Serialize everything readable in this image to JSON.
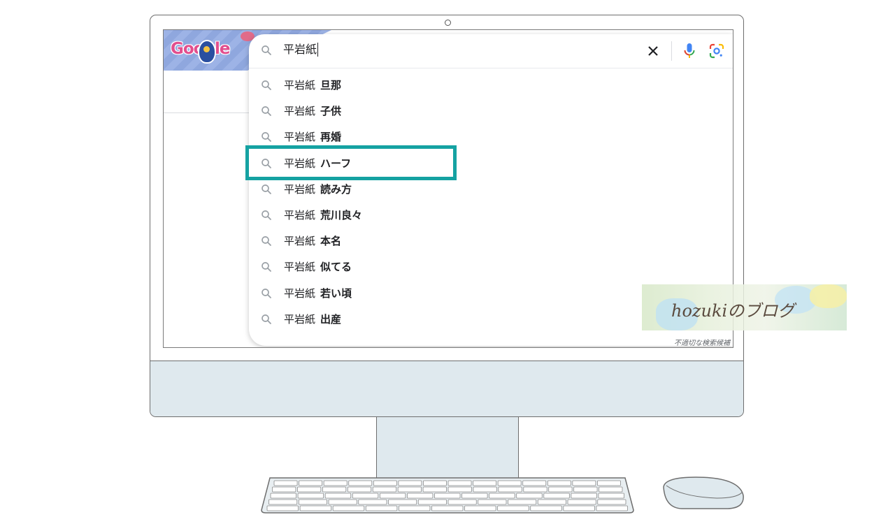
{
  "search": {
    "query": "平岩紙",
    "clear_icon": "close-icon",
    "mic_icon": "microphone-icon",
    "lens_icon": "google-lens-icon"
  },
  "doodle": {
    "logo_text": "Google"
  },
  "suggestions": [
    {
      "query": "平岩紙",
      "completion": "旦那"
    },
    {
      "query": "平岩紙",
      "completion": "子供"
    },
    {
      "query": "平岩紙",
      "completion": "再婚"
    },
    {
      "query": "平岩紙",
      "completion": "ハーフ"
    },
    {
      "query": "平岩紙",
      "completion": "読み方"
    },
    {
      "query": "平岩紙",
      "completion": "荒川良々"
    },
    {
      "query": "平岩紙",
      "completion": "本名"
    },
    {
      "query": "平岩紙",
      "completion": "似てる"
    },
    {
      "query": "平岩紙",
      "completion": "若い頃"
    },
    {
      "query": "平岩紙",
      "completion": "出産"
    }
  ],
  "report_link": "不適切な検索候補",
  "watermark": "hozukiのブログ",
  "colors": {
    "highlight": "#15a2a2",
    "device_fill": "#dfe9ee",
    "outline": "#6e6e6e"
  }
}
